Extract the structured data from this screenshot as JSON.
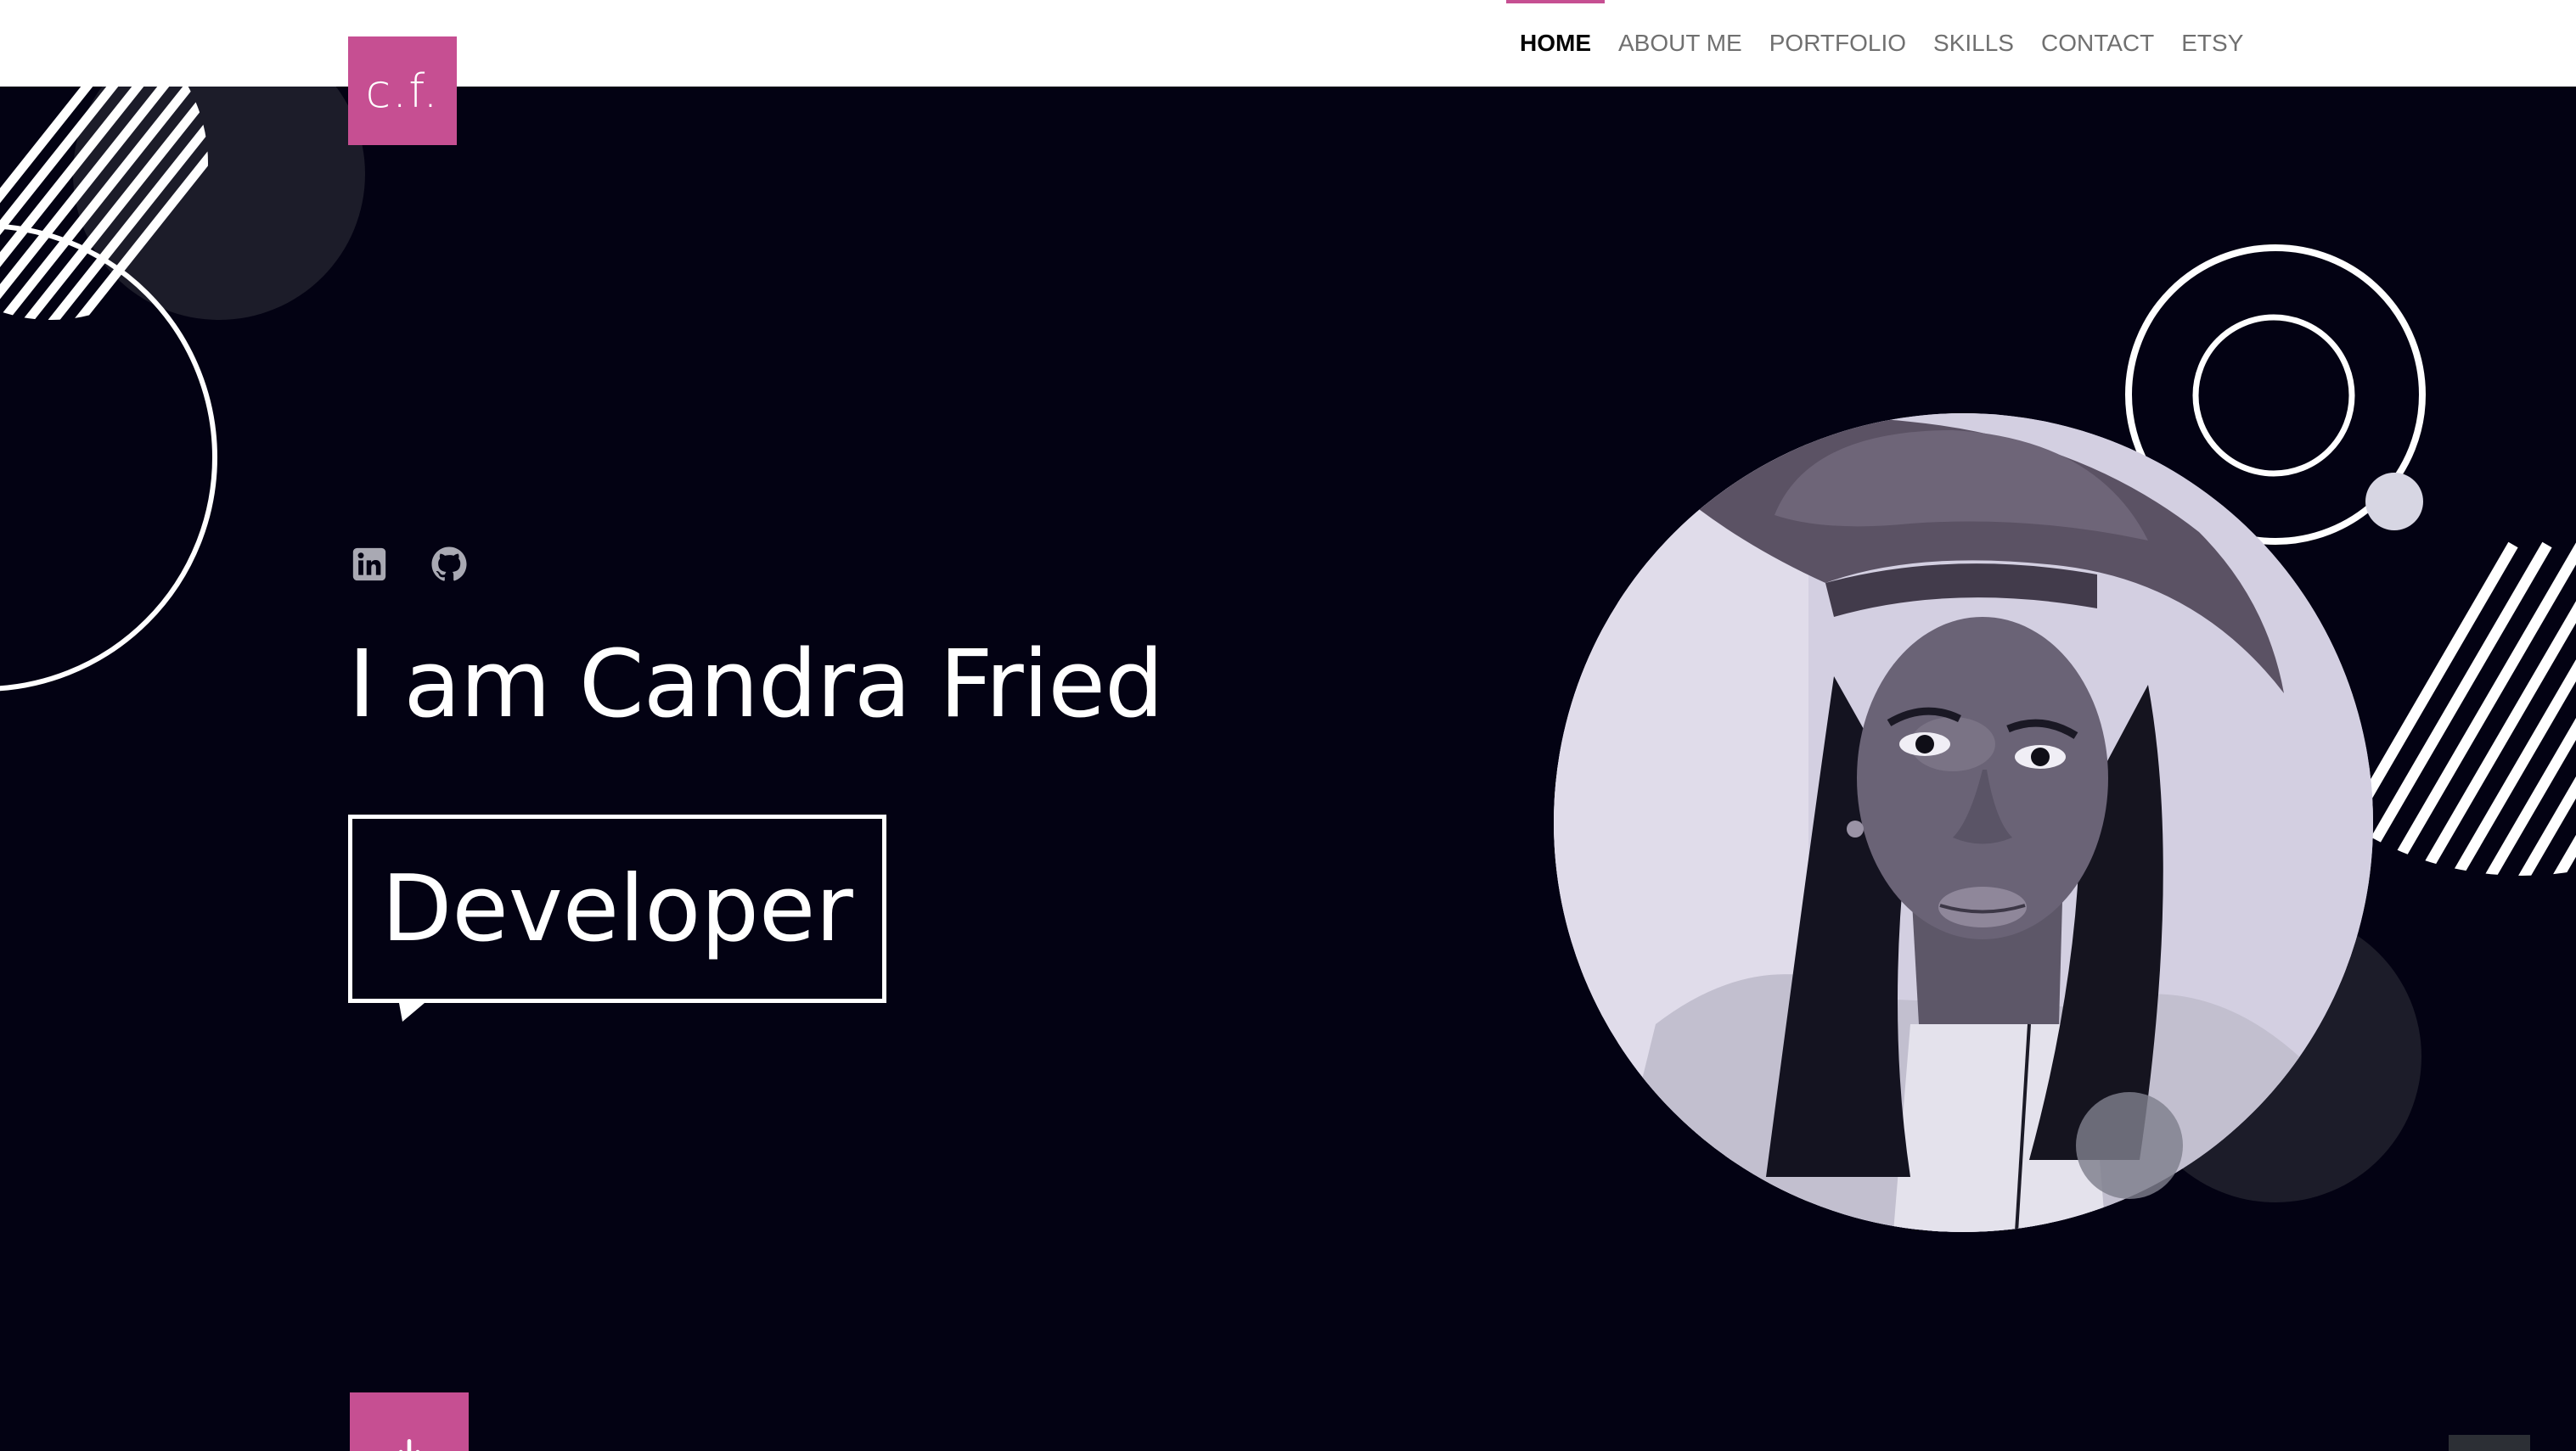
{
  "brand": {
    "logo_text": "c.f.",
    "accent_color": "#c64f92"
  },
  "nav": {
    "items": [
      {
        "label": "HOME",
        "active": true
      },
      {
        "label": "ABOUT ME",
        "active": false
      },
      {
        "label": "PORTFOLIO",
        "active": false
      },
      {
        "label": "SKILLS",
        "active": false
      },
      {
        "label": "CONTACT",
        "active": false
      },
      {
        "label": "ETSY",
        "active": false
      }
    ]
  },
  "hero": {
    "background_color": "#030213",
    "social_icons": [
      "linkedin-icon",
      "github-icon"
    ],
    "headline": "I am Candra Fried",
    "role": "Developer"
  },
  "controls": {
    "scroll_down_icon": "arrow-down-icon",
    "back_to_top_icon": "arrow-up-icon"
  }
}
